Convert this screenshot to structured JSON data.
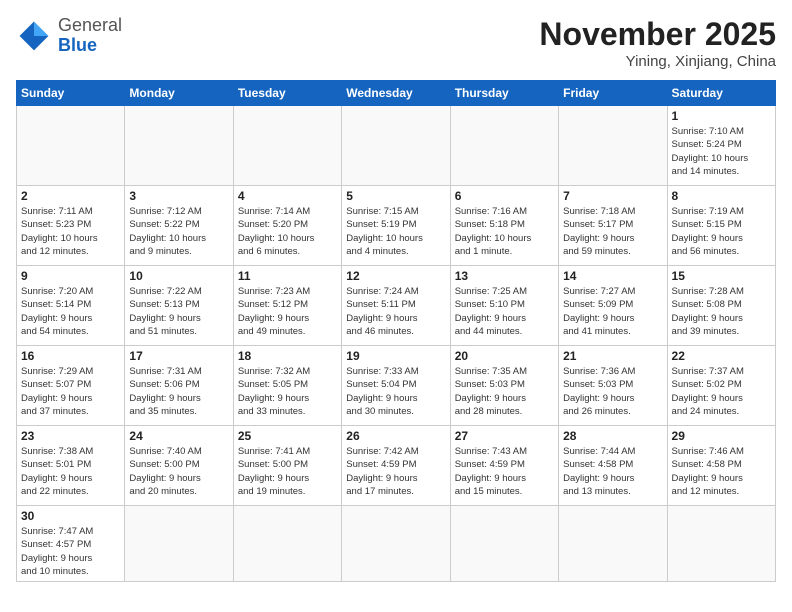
{
  "header": {
    "logo_general": "General",
    "logo_blue": "Blue",
    "month_title": "November 2025",
    "location": "Yining, Xinjiang, China"
  },
  "weekdays": [
    "Sunday",
    "Monday",
    "Tuesday",
    "Wednesday",
    "Thursday",
    "Friday",
    "Saturday"
  ],
  "weeks": [
    [
      {
        "day": "",
        "info": ""
      },
      {
        "day": "",
        "info": ""
      },
      {
        "day": "",
        "info": ""
      },
      {
        "day": "",
        "info": ""
      },
      {
        "day": "",
        "info": ""
      },
      {
        "day": "",
        "info": ""
      },
      {
        "day": "1",
        "info": "Sunrise: 7:10 AM\nSunset: 5:24 PM\nDaylight: 10 hours\nand 14 minutes."
      }
    ],
    [
      {
        "day": "2",
        "info": "Sunrise: 7:11 AM\nSunset: 5:23 PM\nDaylight: 10 hours\nand 12 minutes."
      },
      {
        "day": "3",
        "info": "Sunrise: 7:12 AM\nSunset: 5:22 PM\nDaylight: 10 hours\nand 9 minutes."
      },
      {
        "day": "4",
        "info": "Sunrise: 7:14 AM\nSunset: 5:20 PM\nDaylight: 10 hours\nand 6 minutes."
      },
      {
        "day": "5",
        "info": "Sunrise: 7:15 AM\nSunset: 5:19 PM\nDaylight: 10 hours\nand 4 minutes."
      },
      {
        "day": "6",
        "info": "Sunrise: 7:16 AM\nSunset: 5:18 PM\nDaylight: 10 hours\nand 1 minute."
      },
      {
        "day": "7",
        "info": "Sunrise: 7:18 AM\nSunset: 5:17 PM\nDaylight: 9 hours\nand 59 minutes."
      },
      {
        "day": "8",
        "info": "Sunrise: 7:19 AM\nSunset: 5:15 PM\nDaylight: 9 hours\nand 56 minutes."
      }
    ],
    [
      {
        "day": "9",
        "info": "Sunrise: 7:20 AM\nSunset: 5:14 PM\nDaylight: 9 hours\nand 54 minutes."
      },
      {
        "day": "10",
        "info": "Sunrise: 7:22 AM\nSunset: 5:13 PM\nDaylight: 9 hours\nand 51 minutes."
      },
      {
        "day": "11",
        "info": "Sunrise: 7:23 AM\nSunset: 5:12 PM\nDaylight: 9 hours\nand 49 minutes."
      },
      {
        "day": "12",
        "info": "Sunrise: 7:24 AM\nSunset: 5:11 PM\nDaylight: 9 hours\nand 46 minutes."
      },
      {
        "day": "13",
        "info": "Sunrise: 7:25 AM\nSunset: 5:10 PM\nDaylight: 9 hours\nand 44 minutes."
      },
      {
        "day": "14",
        "info": "Sunrise: 7:27 AM\nSunset: 5:09 PM\nDaylight: 9 hours\nand 41 minutes."
      },
      {
        "day": "15",
        "info": "Sunrise: 7:28 AM\nSunset: 5:08 PM\nDaylight: 9 hours\nand 39 minutes."
      }
    ],
    [
      {
        "day": "16",
        "info": "Sunrise: 7:29 AM\nSunset: 5:07 PM\nDaylight: 9 hours\nand 37 minutes."
      },
      {
        "day": "17",
        "info": "Sunrise: 7:31 AM\nSunset: 5:06 PM\nDaylight: 9 hours\nand 35 minutes."
      },
      {
        "day": "18",
        "info": "Sunrise: 7:32 AM\nSunset: 5:05 PM\nDaylight: 9 hours\nand 33 minutes."
      },
      {
        "day": "19",
        "info": "Sunrise: 7:33 AM\nSunset: 5:04 PM\nDaylight: 9 hours\nand 30 minutes."
      },
      {
        "day": "20",
        "info": "Sunrise: 7:35 AM\nSunset: 5:03 PM\nDaylight: 9 hours\nand 28 minutes."
      },
      {
        "day": "21",
        "info": "Sunrise: 7:36 AM\nSunset: 5:03 PM\nDaylight: 9 hours\nand 26 minutes."
      },
      {
        "day": "22",
        "info": "Sunrise: 7:37 AM\nSunset: 5:02 PM\nDaylight: 9 hours\nand 24 minutes."
      }
    ],
    [
      {
        "day": "23",
        "info": "Sunrise: 7:38 AM\nSunset: 5:01 PM\nDaylight: 9 hours\nand 22 minutes."
      },
      {
        "day": "24",
        "info": "Sunrise: 7:40 AM\nSunset: 5:00 PM\nDaylight: 9 hours\nand 20 minutes."
      },
      {
        "day": "25",
        "info": "Sunrise: 7:41 AM\nSunset: 5:00 PM\nDaylight: 9 hours\nand 19 minutes."
      },
      {
        "day": "26",
        "info": "Sunrise: 7:42 AM\nSunset: 4:59 PM\nDaylight: 9 hours\nand 17 minutes."
      },
      {
        "day": "27",
        "info": "Sunrise: 7:43 AM\nSunset: 4:59 PM\nDaylight: 9 hours\nand 15 minutes."
      },
      {
        "day": "28",
        "info": "Sunrise: 7:44 AM\nSunset: 4:58 PM\nDaylight: 9 hours\nand 13 minutes."
      },
      {
        "day": "29",
        "info": "Sunrise: 7:46 AM\nSunset: 4:58 PM\nDaylight: 9 hours\nand 12 minutes."
      }
    ],
    [
      {
        "day": "30",
        "info": "Sunrise: 7:47 AM\nSunset: 4:57 PM\nDaylight: 9 hours\nand 10 minutes."
      },
      {
        "day": "",
        "info": ""
      },
      {
        "day": "",
        "info": ""
      },
      {
        "day": "",
        "info": ""
      },
      {
        "day": "",
        "info": ""
      },
      {
        "day": "",
        "info": ""
      },
      {
        "day": "",
        "info": ""
      }
    ]
  ]
}
